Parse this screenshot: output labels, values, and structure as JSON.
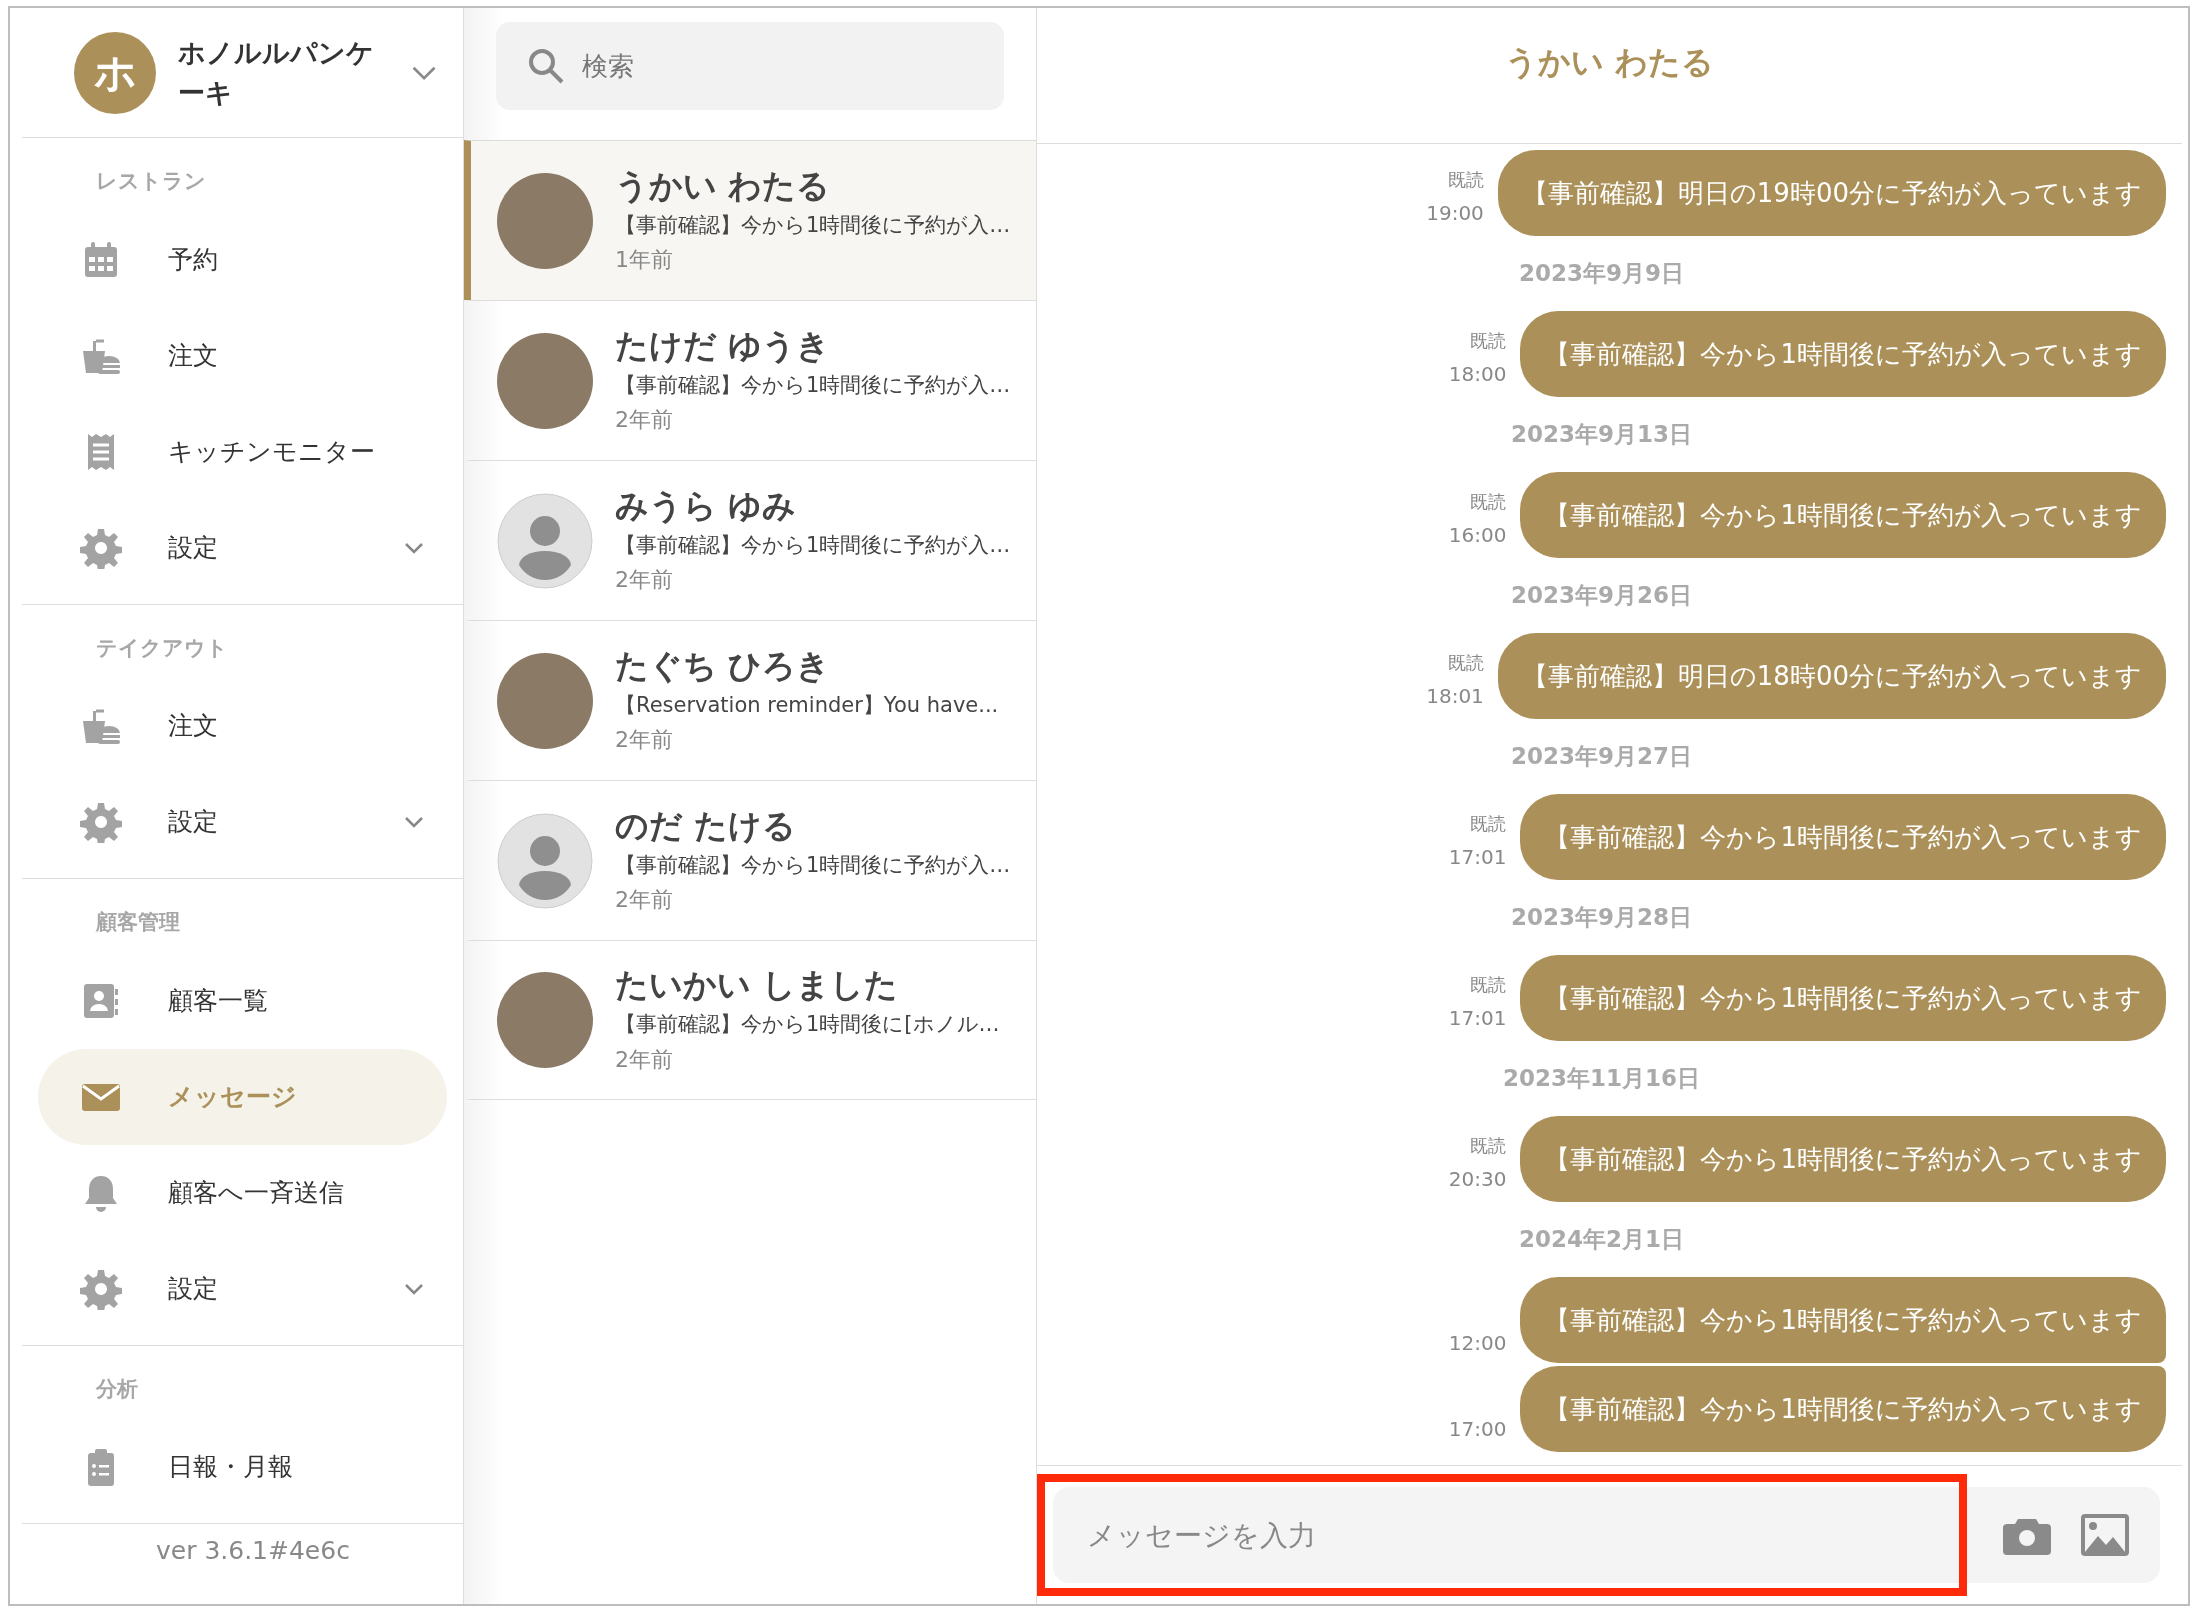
{
  "sidebar": {
    "store": {
      "initial": "ホ",
      "name": "ホノルルパンケーキ"
    },
    "sections": [
      {
        "label": "レストラン",
        "items": [
          {
            "label": "予約",
            "expandable": false,
            "selected": false
          },
          {
            "label": "注文",
            "expandable": false,
            "selected": false
          },
          {
            "label": "キッチンモニター",
            "expandable": false,
            "selected": false
          },
          {
            "label": "設定",
            "expandable": true,
            "selected": false
          }
        ]
      },
      {
        "label": "テイクアウト",
        "items": [
          {
            "label": "注文",
            "expandable": false,
            "selected": false
          },
          {
            "label": "設定",
            "expandable": true,
            "selected": false
          }
        ]
      },
      {
        "label": "顧客管理",
        "items": [
          {
            "label": "顧客一覧",
            "expandable": false,
            "selected": false
          },
          {
            "label": "メッセージ",
            "expandable": false,
            "selected": true
          },
          {
            "label": "顧客へ一斉送信",
            "expandable": false,
            "selected": false
          },
          {
            "label": "設定",
            "expandable": true,
            "selected": false
          }
        ]
      },
      {
        "label": "分析",
        "items": [
          {
            "label": "日報・月報",
            "expandable": false,
            "selected": false
          }
        ]
      }
    ],
    "version": "ver 3.6.1#4e6c"
  },
  "conversation_list": {
    "search": {
      "placeholder": "検索"
    },
    "conversations": [
      {
        "kind": "photo",
        "name": "うかい わたる",
        "preview": "【事前確認】今から1時間後に予約が入…",
        "time": "1年前",
        "selected": true
      },
      {
        "kind": "photo",
        "name": "たけだ ゆうき",
        "preview": "【事前確認】今から1時間後に予約が入…",
        "time": "2年前",
        "selected": false
      },
      {
        "kind": "default",
        "name": "みうら ゆみ",
        "preview": "【事前確認】今から1時間後に予約が入…",
        "time": "2年前",
        "selected": false
      },
      {
        "kind": "photo",
        "name": "たぐち ひろき",
        "preview": "【Reservation reminder】You have...",
        "time": "2年前",
        "selected": false
      },
      {
        "kind": "default",
        "name": "のだ たける",
        "preview": "【事前確認】今から1時間後に予約が入…",
        "time": "2年前",
        "selected": false
      },
      {
        "kind": "photo",
        "name": "たいかい しました",
        "preview": "【事前確認】今から1時間後に[ホノル…",
        "time": "2年前",
        "selected": false
      }
    ]
  },
  "chat": {
    "title": "うかい わたる",
    "messages": [
      {
        "kind": "message",
        "receipt": "既読",
        "time": "19:00",
        "text": "【事前確認】明日の19時00分に予約が入っています"
      },
      {
        "kind": "date",
        "text": "2023年9月9日"
      },
      {
        "kind": "message",
        "receipt": "既読",
        "time": "18:00",
        "text": "【事前確認】今から1時間後に予約が入っています"
      },
      {
        "kind": "date",
        "text": "2023年9月13日"
      },
      {
        "kind": "message",
        "receipt": "既読",
        "time": "16:00",
        "text": "【事前確認】今から1時間後に予約が入っています"
      },
      {
        "kind": "date",
        "text": "2023年9月26日"
      },
      {
        "kind": "message",
        "receipt": "既読",
        "time": "18:01",
        "text": "【事前確認】明日の18時00分に予約が入っています"
      },
      {
        "kind": "date",
        "text": "2023年9月27日"
      },
      {
        "kind": "message",
        "receipt": "既読",
        "time": "17:01",
        "text": "【事前確認】今から1時間後に予約が入っています"
      },
      {
        "kind": "date",
        "text": "2023年9月28日"
      },
      {
        "kind": "message",
        "receipt": "既読",
        "time": "17:01",
        "text": "【事前確認】今から1時間後に予約が入っています"
      },
      {
        "kind": "date",
        "text": "2023年11月16日"
      },
      {
        "kind": "message",
        "receipt": "既読",
        "time": "20:30",
        "text": "【事前確認】今から1時間後に予約が入っています"
      },
      {
        "kind": "date",
        "text": "2024年2月1日"
      },
      {
        "kind": "message",
        "time": "12:00",
        "text": "【事前確認】今から1時間後に予約が入っています"
      },
      {
        "kind": "message",
        "time": "17:00",
        "text": "【事前確認】今から1時間後に予約が入っています"
      }
    ],
    "composer": {
      "placeholder": "メッセージを入力",
      "highlighted": true
    }
  }
}
